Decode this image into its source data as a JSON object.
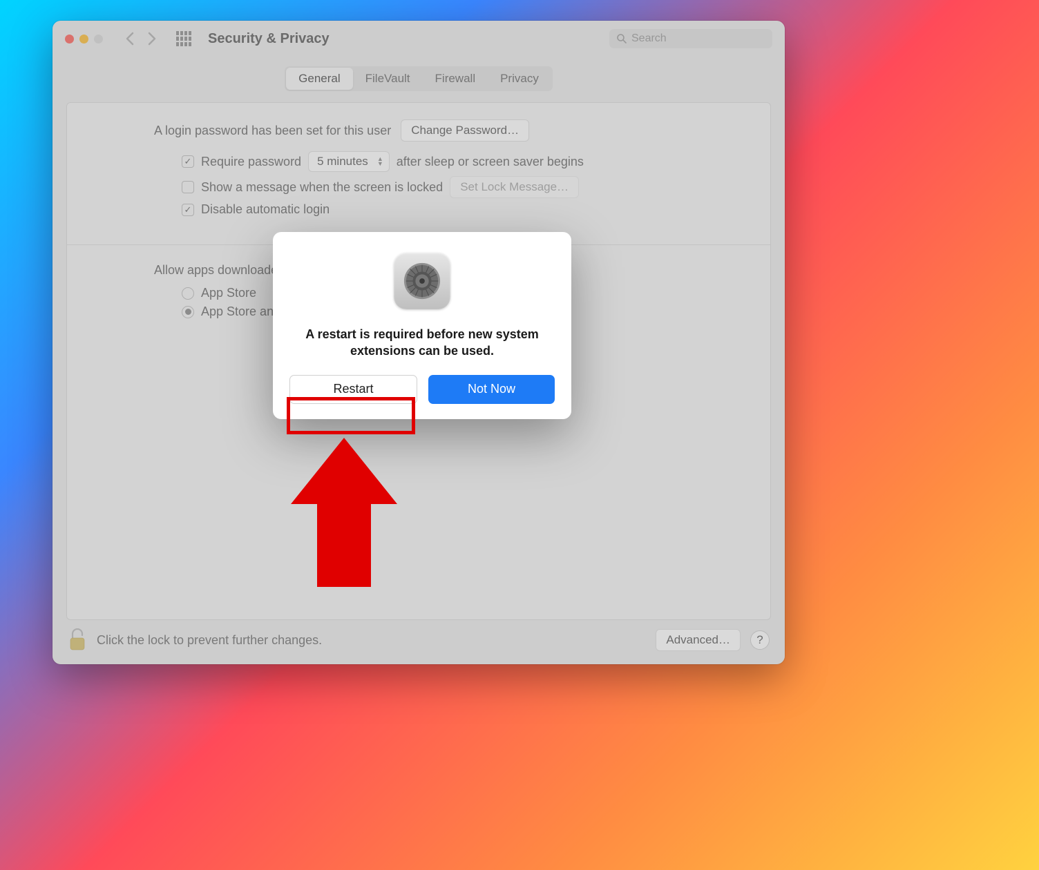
{
  "titlebar": {
    "title": "Security & Privacy",
    "search_placeholder": "Search"
  },
  "tabs": {
    "general": "General",
    "filevault": "FileVault",
    "firewall": "Firewall",
    "privacy": "Privacy"
  },
  "general": {
    "login_password_set": "A login password has been set for this user",
    "change_password": "Change Password…",
    "require_password_label": "Require password",
    "require_password_delay": "5 minutes",
    "after_sleep": "after sleep or screen saver begins",
    "show_message": "Show a message when the screen is locked",
    "set_lock_message": "Set Lock Message…",
    "disable_auto_login": "Disable automatic login",
    "allow_apps_label": "Allow apps downloaded from:",
    "app_store": "App Store",
    "app_store_identified": "App Store and identified developers"
  },
  "footer": {
    "lock_text": "Click the lock to prevent further changes.",
    "advanced": "Advanced…",
    "help": "?"
  },
  "dialog": {
    "message": "A restart is required before new system extensions can be used.",
    "restart": "Restart",
    "not_now": "Not Now"
  }
}
